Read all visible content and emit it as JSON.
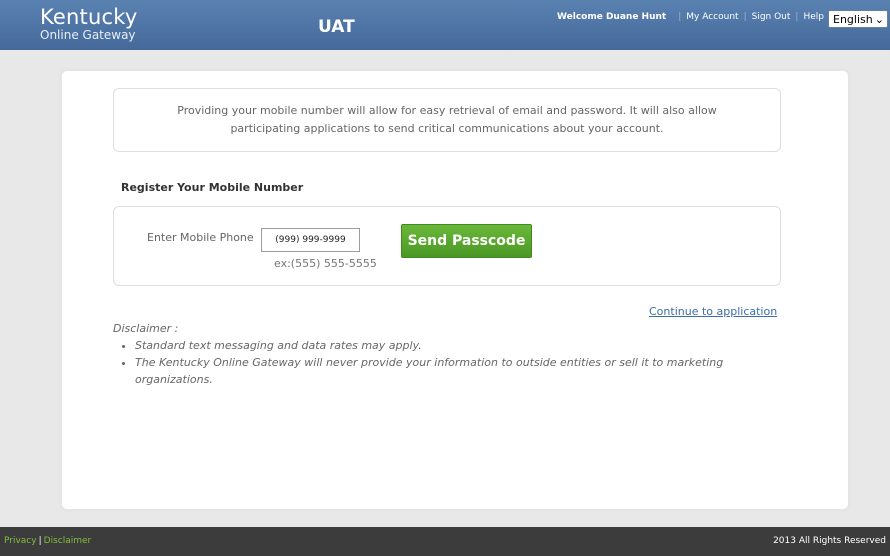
{
  "header": {
    "brand_title": "Kentucky",
    "brand_subtitle": "Online Gateway",
    "environment": "UAT",
    "welcome": "Welcome Duane Hunt",
    "nav": [
      "My Account",
      "Sign Out",
      "Help"
    ],
    "language": "English"
  },
  "info": {
    "message": "Providing your mobile number will allow for easy retrieval of email and password. It will also allow participating applications to send critical communications about your account."
  },
  "register": {
    "title": "Register Your Mobile Number",
    "phone_label": "Enter Mobile Phone",
    "phone_placeholder": "(999) 999-9999",
    "phone_hint": "ex:(555) 555-5555",
    "send_button": "Send Passcode"
  },
  "continue_link": "Continue to application",
  "disclaimer": {
    "label": "Disclaimer :",
    "items": [
      "Standard text messaging and data rates may apply.",
      "The Kentucky Online Gateway will never provide your information to outside entities or sell it to marketing organizations."
    ]
  },
  "footer": {
    "privacy": "Privacy",
    "disclaimer": "Disclaimer",
    "copyright": "2013 All Rights Reserved"
  },
  "colors": {
    "header_bg": "#4a73a3",
    "button_green": "#5aa82f",
    "link_blue": "#3b6ea8",
    "footer_bg": "#3c3c3c",
    "footer_link": "#7fbf3f"
  }
}
